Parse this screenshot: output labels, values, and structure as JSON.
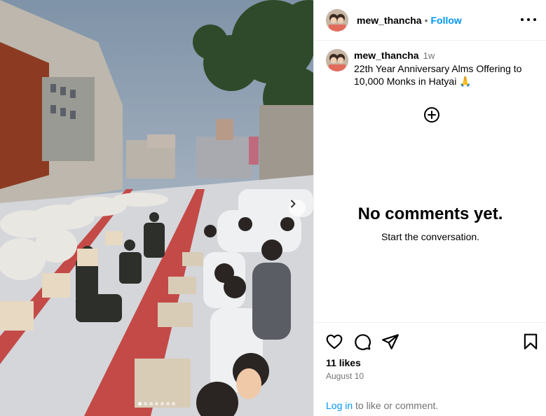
{
  "post": {
    "username": "mew_thancha",
    "follow_label": "Follow",
    "separator": "•",
    "caption_time": "1w",
    "caption_text": "22th Year Anniversary Alms Offering to 10,000 Monks in Hatyai 🙏",
    "likes": "11 likes",
    "date": "August 10"
  },
  "comments": {
    "empty_title": "No comments yet.",
    "empty_subtitle": "Start the conversation."
  },
  "footer": {
    "login_link": "Log in",
    "login_suffix": " to like or comment."
  },
  "carousel": {
    "slide_count": 7,
    "active_index": 0
  },
  "icons": {
    "more": "more-horizontal-icon",
    "add": "add-circle-icon",
    "like": "heart-icon",
    "comment": "comment-icon",
    "share": "share-icon",
    "save": "bookmark-icon",
    "next": "chevron-right-icon"
  },
  "colors": {
    "link": "#0095f6",
    "muted": "#737373",
    "border": "#efefef"
  }
}
